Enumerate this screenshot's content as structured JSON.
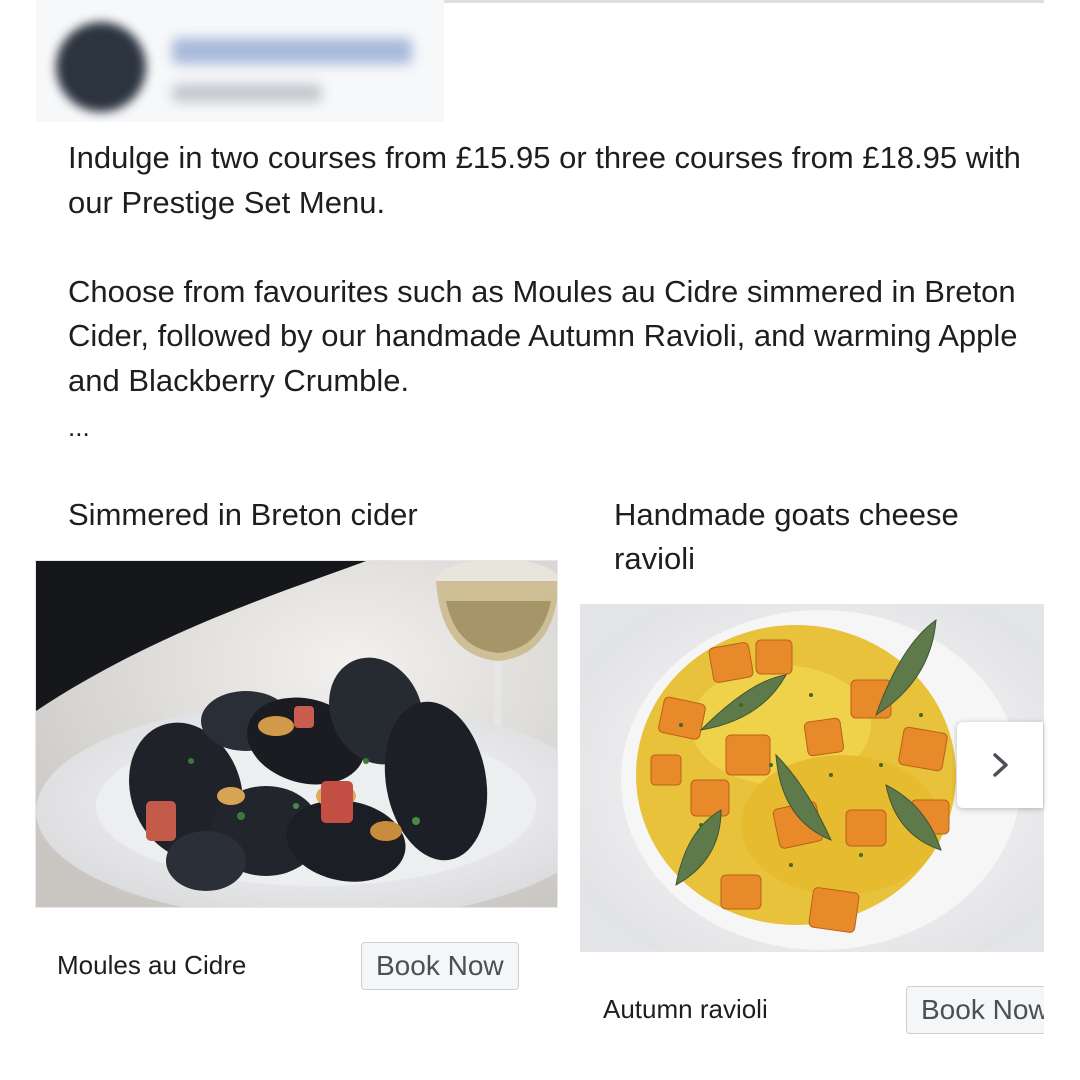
{
  "post": {
    "paragraphs": [
      "Indulge in two courses from £15.95 or three courses from £18.95 with our Prestige Set Menu.",
      "Choose from favourites such as Moules au Cidre simmered in Breton Cider, followed by our handmade Autumn Ravioli, and warming Apple and Blackberry Crumble."
    ],
    "see_more": "..."
  },
  "carousel": {
    "cards": [
      {
        "headline": "Simmered in Breton cider",
        "title": "Moules au Cidre",
        "cta": "Book Now",
        "image": "mussels-dish"
      },
      {
        "headline": "Handmade goats cheese ravioli",
        "title": "Autumn ravioli",
        "cta": "Book Now",
        "image": "ravioli-dish"
      }
    ],
    "next_icon": "chevron-right-icon"
  },
  "colors": {
    "text": "#1c1e21",
    "button_bg": "#f5f6f7",
    "button_border": "#ccd0d5",
    "button_text": "#4b4f56"
  }
}
